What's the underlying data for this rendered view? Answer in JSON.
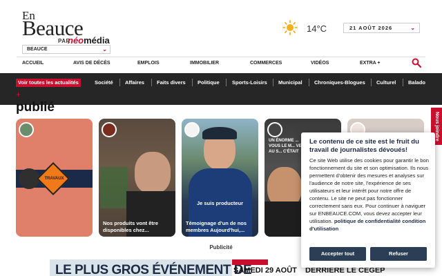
{
  "header": {
    "logo_en": "En",
    "logo_beauce": "Beauce",
    "logo_par": "PAR",
    "logo_neo": "néo",
    "logo_media": "média",
    "region_select": "BEAUCE",
    "temperature": "14°C",
    "date_select": "21 AOÛT 2026",
    "weather_icon": "sun-icon",
    "search_icon": "search-icon"
  },
  "main_nav": [
    "ACCUEIL",
    "AVIS DE DÉCÈS",
    "EMPLOIS",
    "IMMOBILIER",
    "COMMERCES",
    "VIDÉOS",
    "EXTRA +"
  ],
  "sub_nav": {
    "highlight": "Voir toutes les actualités",
    "items": [
      "Société",
      "Affaires",
      "Faits divers",
      "Politique",
      "Sports-Loisirs",
      "Municipal",
      "Chroniques-Blogues",
      "Culturel",
      "Balado"
    ],
    "more": "+"
  },
  "section_title": "publié",
  "stories": [
    {
      "caption": "",
      "overlay": "TRAVAUX"
    },
    {
      "caption": "Nos produits vont être disponibles chez...",
      "overlay": ""
    },
    {
      "caption": "Témoignage d'un de nos membres Aujourd'hui,...",
      "overlay": "Je suis producteur"
    },
    {
      "caption": "",
      "overlay": "UN ÉNORME ... VOUS LE M... VENU AU S... C'ÉTAIT"
    },
    {
      "caption": "",
      "overlay": ""
    }
  ],
  "side_tab": "Nous joindre",
  "ad": {
    "label": "Publicité",
    "headline": "LE PLUS GROS ÉVÉNEMENT DE",
    "date": "SAMEDI 29 AOÛT",
    "place": "DERRIÈRE LE CEGEP"
  },
  "cookie": {
    "title": "Le contenu de ce site est le fruit du travail de journalistes dévoués!",
    "body_1": "Ce site Web utilise des cookies pour garantir le bon fonctionnement du site et son optimisation. Ils nous permettent d'obtenir des mesures et analyses sur l'audience de notre site, l'expérience de ses utilisateurs et leur intérêt pour notre offre de contenu. Le site ne peut pas fonctionner correctement sans eux. Pour continuer à naviguer sur ENBEAUCE.COM, vous devez accepter leur utilisation.",
    "link": "politique de confidentialité",
    "link_2": "condition d'utilisation",
    "accept": "Accepter tout",
    "refuse": "Refuser"
  },
  "colors": {
    "brand_red": "#c8102e",
    "dark_bar": "#262626",
    "navy": "#2c3e56"
  }
}
